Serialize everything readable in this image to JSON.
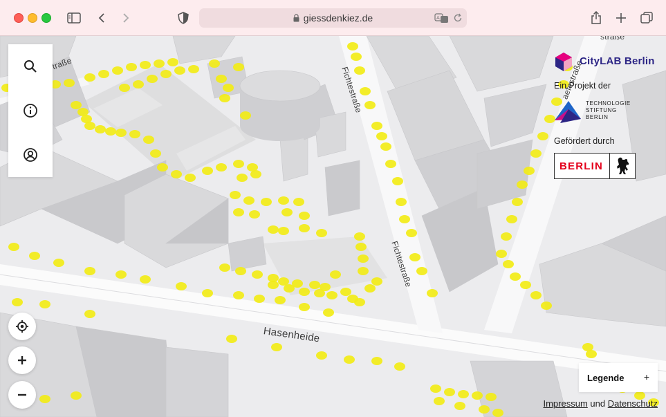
{
  "browser": {
    "url": "giessdenkiez.de"
  },
  "map": {
    "streets": {
      "fichte_top": "Fichtestraße",
      "fichte_mid": "Fichtestraße",
      "hasenheide": "Hasenheide",
      "top_left": "straße",
      "top_right": "straße",
      "right": "aefestraße"
    }
  },
  "credits": {
    "citylab": "CityLAB Berlin",
    "project_label": "Ein Projekt der",
    "tsb_lines": [
      "TECHNOLOGIE",
      "STIFTUNG",
      "BERLIN"
    ],
    "funded_label": "Gefördert durch",
    "berlin": "BERLIN"
  },
  "legend": {
    "title": "Legende",
    "toggle": "+"
  },
  "footer": {
    "impressum": "Impressum",
    "und": "und",
    "datenschutz": "Datenschutz"
  },
  "colors": {
    "tree": "#f2ec17",
    "chrome_bg": "#fdecee",
    "citylab_blue": "#2c2585",
    "berlin_red": "#e4001b"
  }
}
